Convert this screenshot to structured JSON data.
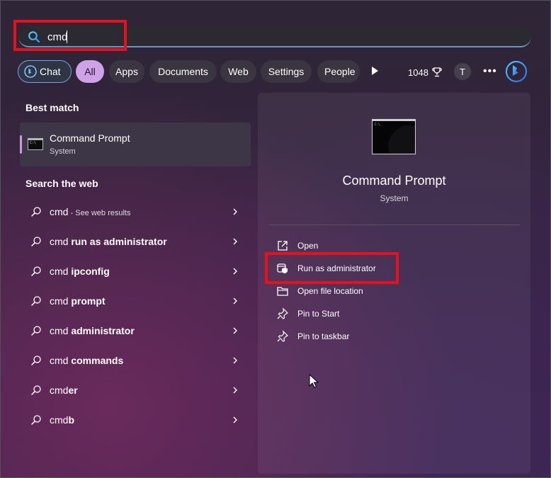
{
  "search": {
    "value": "cmd"
  },
  "filters": {
    "chat": "Chat",
    "all": "All",
    "apps": "Apps",
    "documents": "Documents",
    "web": "Web",
    "settings": "Settings",
    "people": "People",
    "points": "1048",
    "avatar_initial": "T",
    "more": "•••"
  },
  "best_match": {
    "heading": "Best match",
    "title": "Command Prompt",
    "subtitle": "System"
  },
  "web_search": {
    "heading": "Search the web",
    "items": [
      {
        "query": "cmd",
        "suffix": "",
        "hint": " - See web results"
      },
      {
        "query": "cmd ",
        "suffix": "run as administrator",
        "hint": ""
      },
      {
        "query": "cmd ",
        "suffix": "ipconfig",
        "hint": ""
      },
      {
        "query": "cmd ",
        "suffix": "prompt",
        "hint": ""
      },
      {
        "query": "cmd ",
        "suffix": "administrator",
        "hint": ""
      },
      {
        "query": "cmd ",
        "suffix": "commands",
        "hint": ""
      },
      {
        "query": "cmd",
        "suffix": "er",
        "hint": ""
      },
      {
        "query": "cmd",
        "suffix": "b",
        "hint": ""
      }
    ]
  },
  "details": {
    "title": "Command Prompt",
    "subtitle": "System",
    "actions": [
      {
        "label": "Open",
        "icon": "open-external-icon"
      },
      {
        "label": "Run as administrator",
        "icon": "shield-admin-icon"
      },
      {
        "label": "Open file location",
        "icon": "folder-icon"
      },
      {
        "label": "Pin to Start",
        "icon": "pin-icon"
      },
      {
        "label": "Pin to taskbar",
        "icon": "pin-icon"
      }
    ]
  },
  "colors": {
    "accent": "#cfa1e6",
    "highlight": "#e8101a",
    "chat_border": "#6aa6e8"
  }
}
